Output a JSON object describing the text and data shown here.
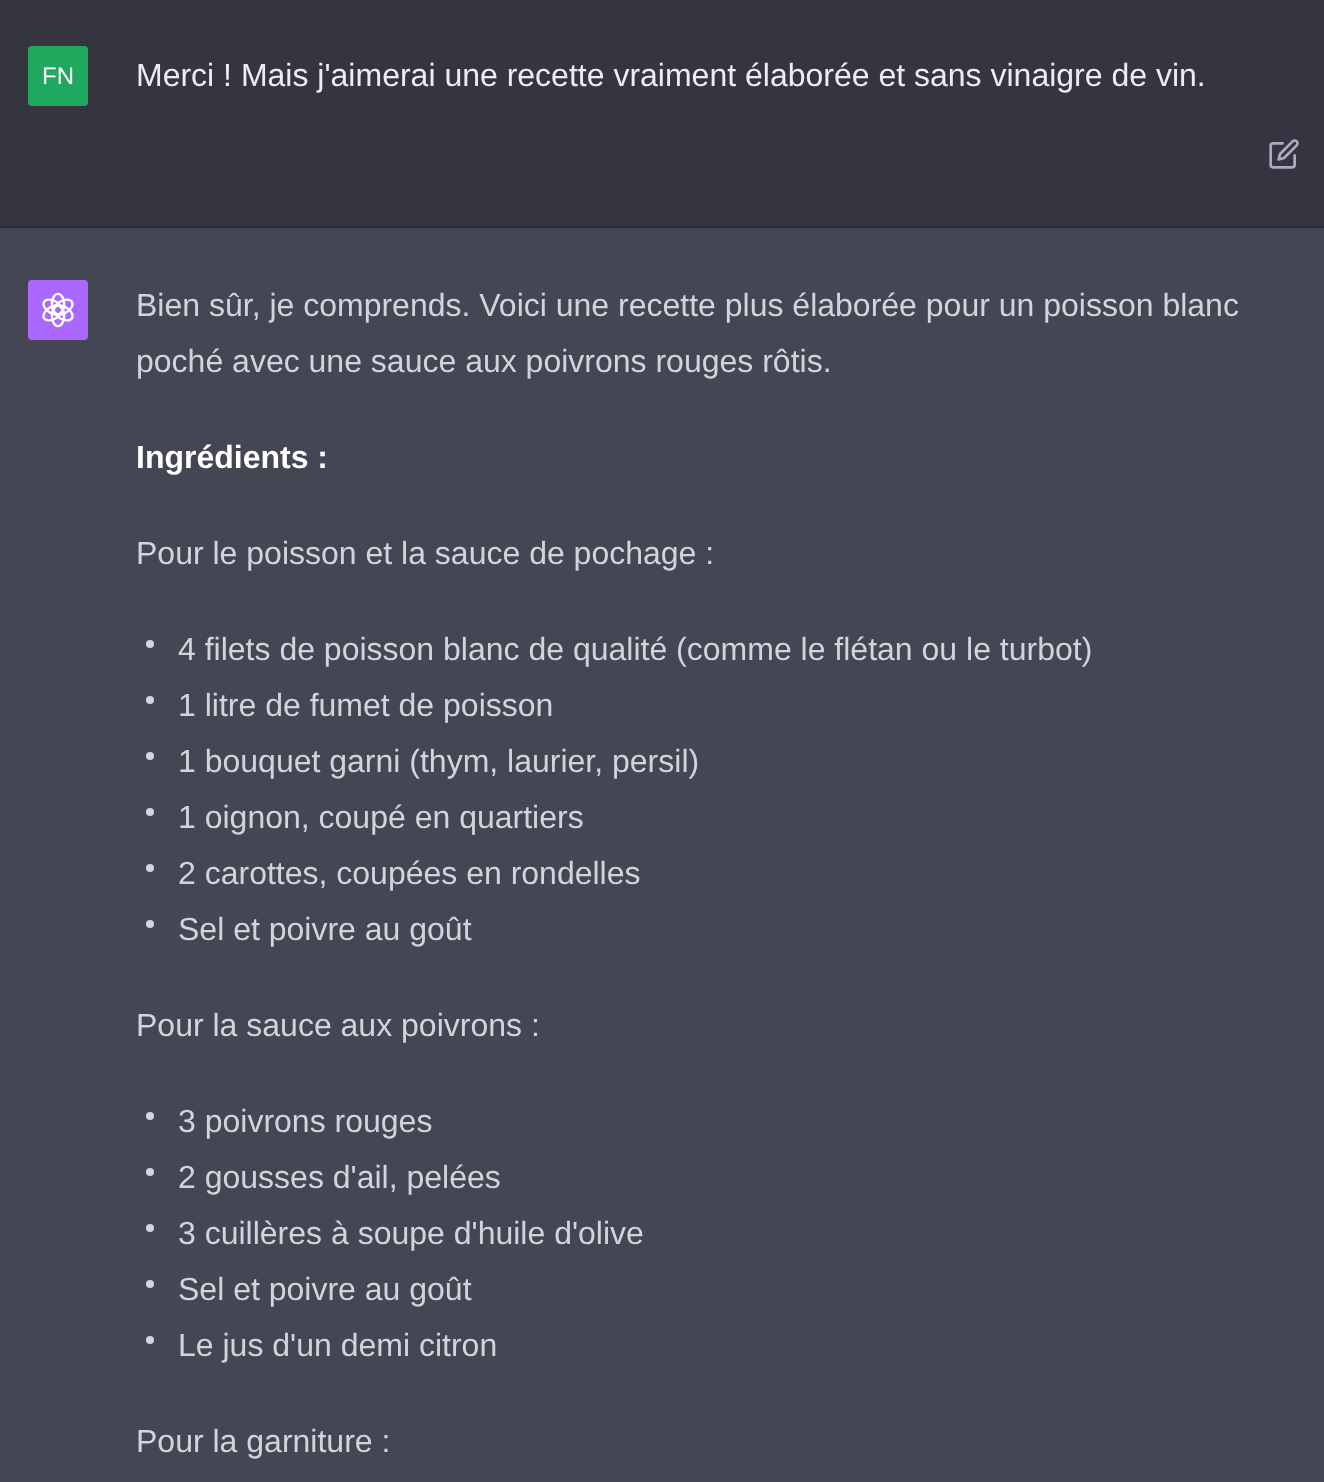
{
  "user_message": {
    "avatar": "FN",
    "text": "Merci ! Mais j'aimerai une recette vraiment élaborée et sans vinaigre de vin."
  },
  "assistant_message": {
    "blocks": [
      {
        "kind": "paragraph",
        "text": "Bien sûr, je comprends. Voici une recette plus élaborée pour un poisson blanc poché avec une sauce aux poivrons rouges rôtis."
      },
      {
        "kind": "heading",
        "text": "Ingrédients :"
      },
      {
        "kind": "paragraph",
        "text": "Pour le poisson et la sauce de pochage :"
      },
      {
        "kind": "list",
        "items": [
          "4 filets de poisson blanc de qualité (comme le flétan ou le turbot)",
          "1 litre de fumet de poisson",
          "1 bouquet garni (thym, laurier, persil)",
          "1 oignon, coupé en quartiers",
          "2 carottes, coupées en rondelles",
          "Sel et poivre au goût"
        ]
      },
      {
        "kind": "paragraph",
        "text": "Pour la sauce aux poivrons :"
      },
      {
        "kind": "list",
        "items": [
          "3 poivrons rouges",
          "2 gousses d'ail, pelées",
          "3 cuillères à soupe d'huile d'olive",
          "Sel et poivre au goût",
          "Le jus d'un demi citron"
        ]
      },
      {
        "kind": "paragraph",
        "text": "Pour la garniture :"
      }
    ]
  }
}
